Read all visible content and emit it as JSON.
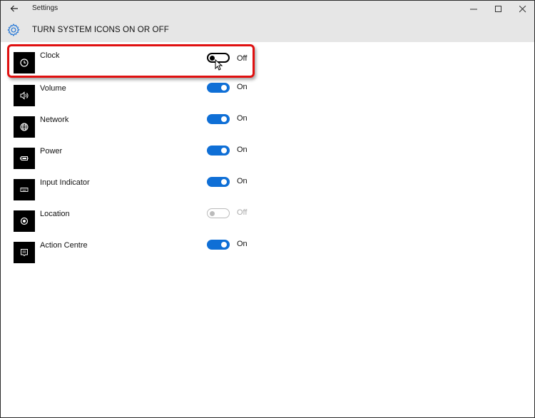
{
  "window": {
    "title": "Settings",
    "back_icon": "back-arrow-icon",
    "controls": [
      "minimize",
      "maximize",
      "close"
    ]
  },
  "header": {
    "icon": "gear-icon",
    "title": "TURN SYSTEM ICONS ON OR OFF"
  },
  "colors": {
    "accent": "#0f6fd6",
    "highlight": "#e01010",
    "header_bg": "#e6e6e6"
  },
  "items": [
    {
      "label": "Clock",
      "icon": "clock-icon",
      "state": "Off",
      "enabled": true,
      "highlighted": true
    },
    {
      "label": "Volume",
      "icon": "volume-icon",
      "state": "On",
      "enabled": true
    },
    {
      "label": "Network",
      "icon": "network-globe-icon",
      "state": "On",
      "enabled": true
    },
    {
      "label": "Power",
      "icon": "battery-icon",
      "state": "On",
      "enabled": true
    },
    {
      "label": "Input Indicator",
      "icon": "keyboard-icon",
      "state": "On",
      "enabled": true
    },
    {
      "label": "Location",
      "icon": "location-icon",
      "state": "Off",
      "enabled": false
    },
    {
      "label": "Action Centre",
      "icon": "action-centre-icon",
      "state": "On",
      "enabled": true
    }
  ]
}
